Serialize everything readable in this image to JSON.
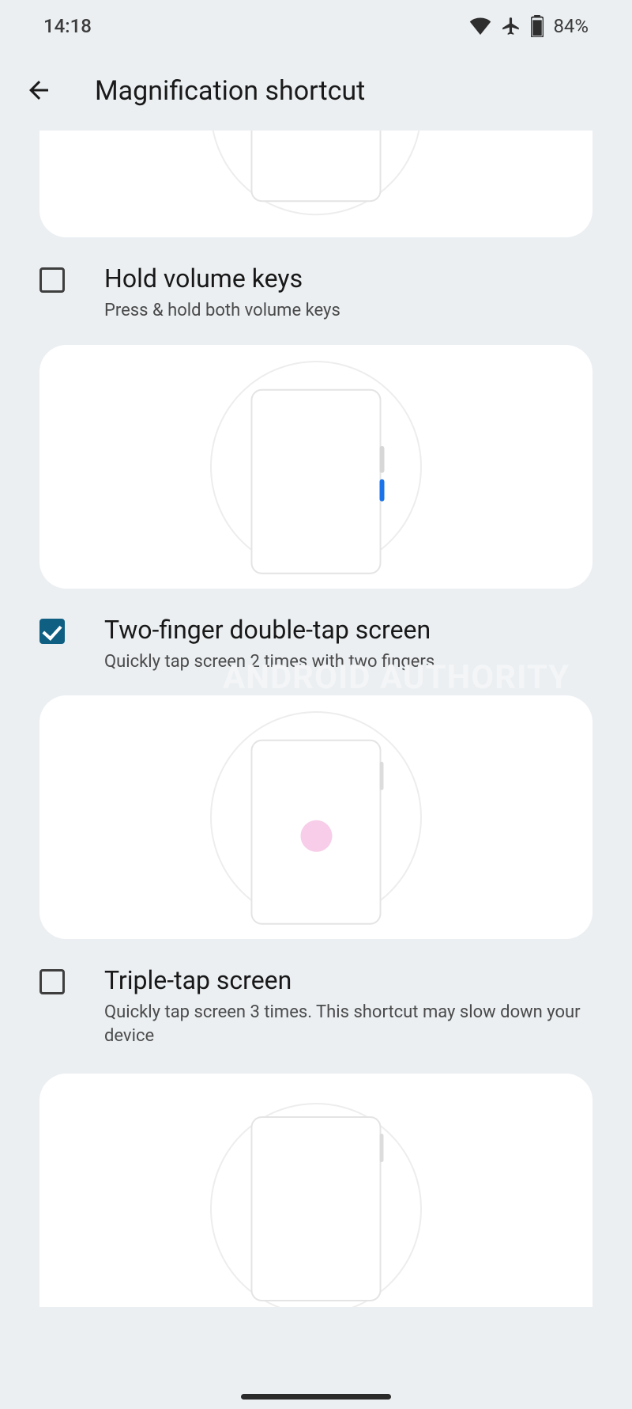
{
  "status": {
    "time": "14:18",
    "battery_text": "84%"
  },
  "header": {
    "title": "Magnification shortcut"
  },
  "options": {
    "hold_volume": {
      "title": "Hold volume keys",
      "desc": "Press & hold both volume keys",
      "checked": false
    },
    "two_finger": {
      "title": "Two-finger double-tap screen",
      "desc": "Quickly tap screen 2 times with two fingers",
      "checked": true
    },
    "triple_tap": {
      "title": "Triple-tap screen",
      "desc": "Quickly tap screen 3 times. This shortcut may slow down your device",
      "checked": false
    }
  },
  "watermark": "ANDROID AUTHORITY"
}
